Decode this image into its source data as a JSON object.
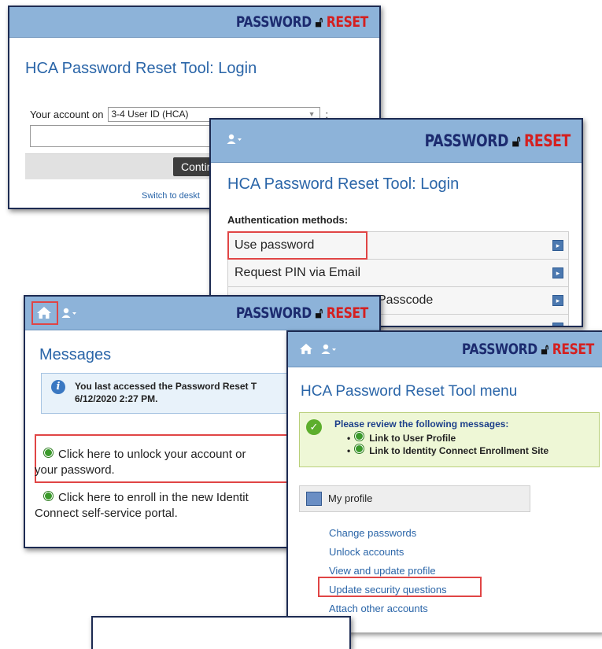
{
  "brand": {
    "password": "PASSWORD",
    "reset": "RESET",
    "lock_icon": "padlock-icon"
  },
  "login1": {
    "title": "HCA Password Reset Tool: Login",
    "account_label": "Your account on",
    "account_select": "3-4 User ID (HCA)",
    "colon": ":",
    "continue_label": "Continu",
    "switch_label": "Switch to deskt"
  },
  "login2": {
    "title": "HCA Password Reset Tool: Login",
    "auth_label": "Authentication methods:",
    "methods": [
      "Use password",
      "Request PIN via Email",
      "Passcode",
      ""
    ]
  },
  "messages": {
    "title": "Messages",
    "info_line1": "You last accessed the Password Reset T",
    "info_line2": "6/12/2020 2:27 PM.",
    "msg1_line1": "Click here to unlock your account or",
    "msg1_line2": "your password.",
    "msg2_line1": "Click here to enroll in the new Identit",
    "msg2_line2": "Connect self-service portal."
  },
  "menu": {
    "title": "HCA Password Reset Tool menu",
    "review_title": "Please review the following messages:",
    "review_items": [
      "Link to User Profile",
      "Link to Identity Connect Enrollment Site"
    ],
    "profile_label": "My profile",
    "links": [
      "Change passwords",
      "Unlock accounts",
      "View and update profile",
      "Update security questions",
      "Attach other accounts"
    ]
  },
  "colors": {
    "bar": "#8db3d9",
    "title": "#2a65a8",
    "highlight": "#e04545",
    "brand_blue": "#1c2b6f",
    "brand_red": "#d42020"
  }
}
